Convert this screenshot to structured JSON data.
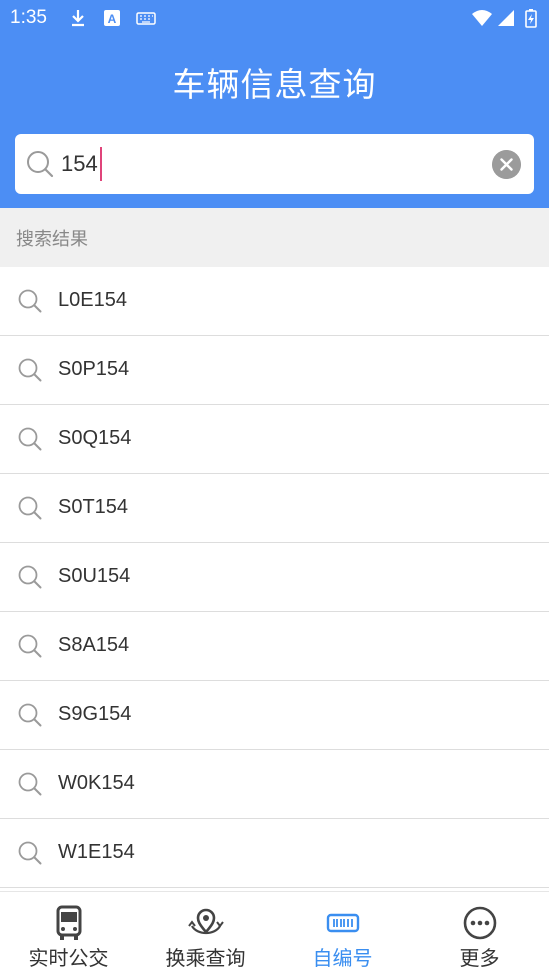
{
  "status_bar": {
    "time": "1:35"
  },
  "header": {
    "title": "车辆信息查询"
  },
  "search": {
    "value": "154"
  },
  "results": {
    "section_label": "搜索结果",
    "items": [
      "L0E154",
      "S0P154",
      "S0Q154",
      "S0T154",
      "S0U154",
      "S8A154",
      "S9G154",
      "W0K154",
      "W1E154"
    ]
  },
  "tabbar": {
    "tabs": [
      {
        "label": "实时公交",
        "icon": "bus-icon"
      },
      {
        "label": "换乘查询",
        "icon": "transfer-location-icon"
      },
      {
        "label": "自编号",
        "icon": "vehicle-number-icon",
        "active": true
      },
      {
        "label": "更多",
        "icon": "more-icon"
      }
    ]
  },
  "colors": {
    "header_bg": "#4c8ef4",
    "active_tab": "#3a8ef0",
    "caret": "#e0447a",
    "section_bg": "#f0f0f0"
  }
}
